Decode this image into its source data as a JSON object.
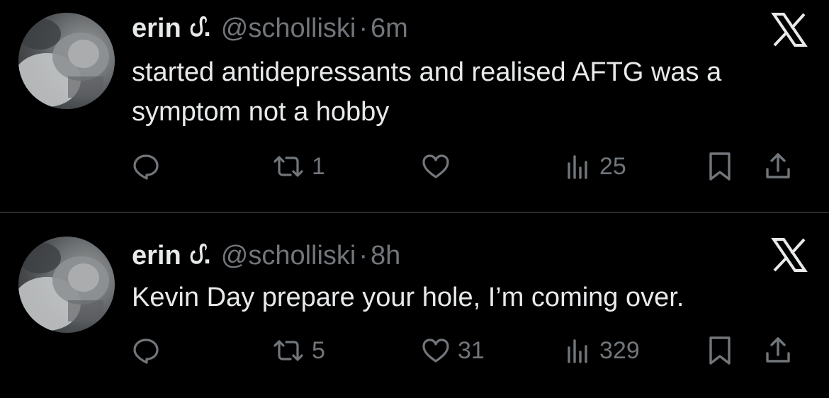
{
  "tweets": [
    {
      "author": {
        "name": "erin",
        "name_glyph": "ᦔ.",
        "handle": "@scholliski"
      },
      "separator": "·",
      "time": "6m",
      "text": "started antidepressants and realised AFTG was a symptom not a hobby",
      "actions": {
        "replies": "",
        "retweets": "1",
        "likes": "",
        "views": "25"
      }
    },
    {
      "author": {
        "name": "erin",
        "name_glyph": "ᦔ.",
        "handle": "@scholliski"
      },
      "separator": "·",
      "time": "8h",
      "text": "Kevin Day prepare your hole, I’m coming over.",
      "actions": {
        "replies": "",
        "retweets": "5",
        "likes": "31",
        "views": "329"
      }
    }
  ],
  "icons": {
    "reply": "reply-icon",
    "retweet": "retweet-icon",
    "like": "heart-icon",
    "views": "views-icon",
    "bookmark": "bookmark-icon",
    "share": "share-icon",
    "brand": "x-logo-icon"
  },
  "colors": {
    "background": "#000000",
    "primary_text": "#e7e9ea",
    "secondary_text": "#71767b",
    "divider": "#2a2d30"
  }
}
